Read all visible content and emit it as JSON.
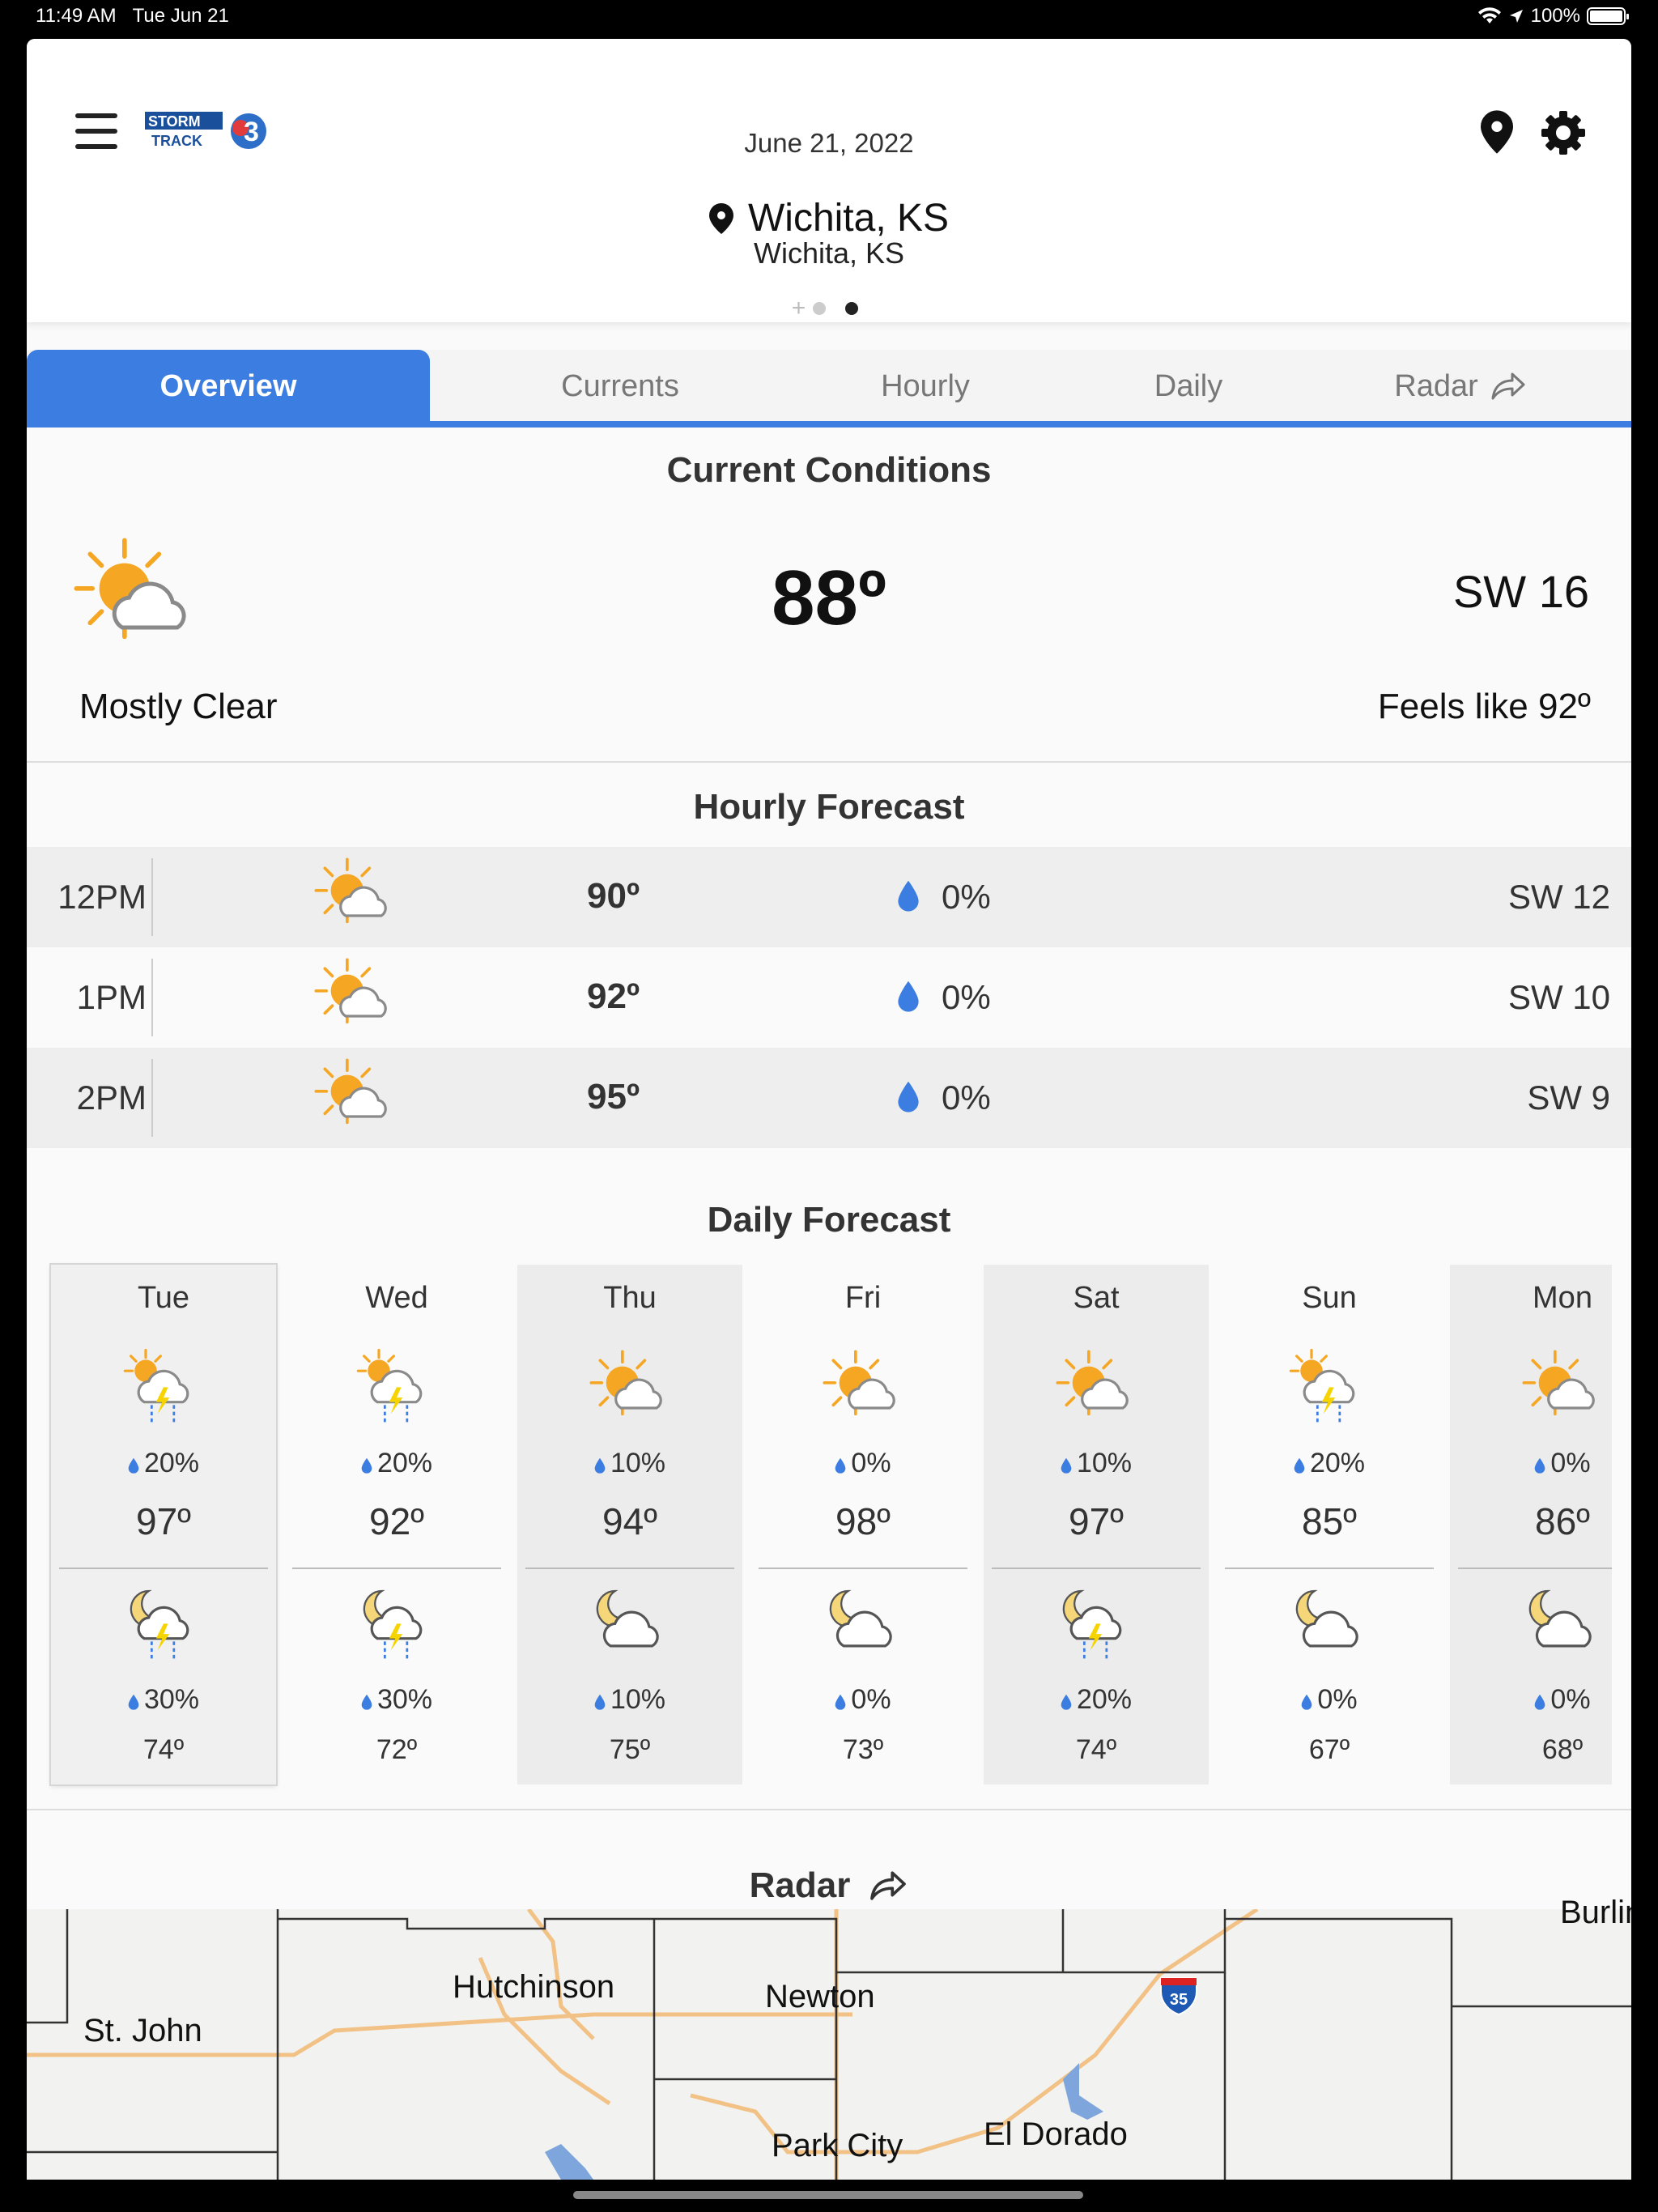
{
  "status": {
    "time": "11:49 AM",
    "date": "Tue Jun 21",
    "battery": "100%"
  },
  "header": {
    "logo_text_top": "STORM",
    "logo_text_bottom": "TRACK",
    "logo_number": "3",
    "date": "June 21, 2022",
    "location_main": "Wichita, KS",
    "location_sub": "Wichita, KS",
    "page_count": 2,
    "active_page": 2
  },
  "tabs": [
    {
      "label": "Overview",
      "active": true
    },
    {
      "label": "Currents",
      "active": false
    },
    {
      "label": "Hourly",
      "active": false
    },
    {
      "label": "Daily",
      "active": false
    },
    {
      "label": "Radar",
      "active": false
    }
  ],
  "current": {
    "title": "Current Conditions",
    "temp": "88º",
    "wind": "SW 16",
    "condition": "Mostly Clear",
    "feels_like": "Feels like 92º",
    "icon": "partly-sunny-icon"
  },
  "hourly": {
    "title": "Hourly Forecast",
    "rows": [
      {
        "time": "12PM",
        "temp": "90º",
        "precip": "0%",
        "wind": "SW 12",
        "icon": "partly-sunny-icon"
      },
      {
        "time": "1PM",
        "temp": "92º",
        "precip": "0%",
        "wind": "SW 10",
        "icon": "partly-sunny-icon"
      },
      {
        "time": "2PM",
        "temp": "95º",
        "precip": "0%",
        "wind": "SW 9",
        "icon": "partly-sunny-icon"
      }
    ]
  },
  "daily": {
    "title": "Daily Forecast",
    "days": [
      {
        "name": "Tue",
        "day_icon": "sun-thunderstorm-icon",
        "day_precip": "20%",
        "high": "97º",
        "night_icon": "moon-thunderstorm-icon",
        "night_precip": "30%",
        "low": "74º"
      },
      {
        "name": "Wed",
        "day_icon": "sun-thunderstorm-icon",
        "day_precip": "20%",
        "high": "92º",
        "night_icon": "moon-thunderstorm-icon",
        "night_precip": "30%",
        "low": "72º"
      },
      {
        "name": "Thu",
        "day_icon": "partly-sunny-icon",
        "day_precip": "10%",
        "high": "94º",
        "night_icon": "moon-cloud-icon",
        "night_precip": "10%",
        "low": "75º"
      },
      {
        "name": "Fri",
        "day_icon": "partly-sunny-icon",
        "day_precip": "0%",
        "high": "98º",
        "night_icon": "moon-cloud-icon",
        "night_precip": "0%",
        "low": "73º"
      },
      {
        "name": "Sat",
        "day_icon": "partly-sunny-icon",
        "day_precip": "10%",
        "high": "97º",
        "night_icon": "moon-thunderstorm-icon",
        "night_precip": "20%",
        "low": "74º"
      },
      {
        "name": "Sun",
        "day_icon": "sun-thunderstorm-icon",
        "day_precip": "20%",
        "high": "85º",
        "night_icon": "moon-cloud-icon",
        "night_precip": "0%",
        "low": "67º"
      },
      {
        "name": "Mon",
        "day_icon": "partly-sunny-icon",
        "day_precip": "0%",
        "high": "86º",
        "night_icon": "moon-cloud-icon",
        "night_precip": "0%",
        "low": "68º"
      }
    ]
  },
  "radar": {
    "title": "Radar",
    "cities": [
      "St. John",
      "Hutchinson",
      "Newton",
      "El Dorado",
      "Park City",
      "Burling"
    ],
    "interstate": "35"
  },
  "colors": {
    "accent": "#3b7de0",
    "sun": "#f5a623",
    "drop": "#3b7de0",
    "bolt": "#f5d400"
  }
}
